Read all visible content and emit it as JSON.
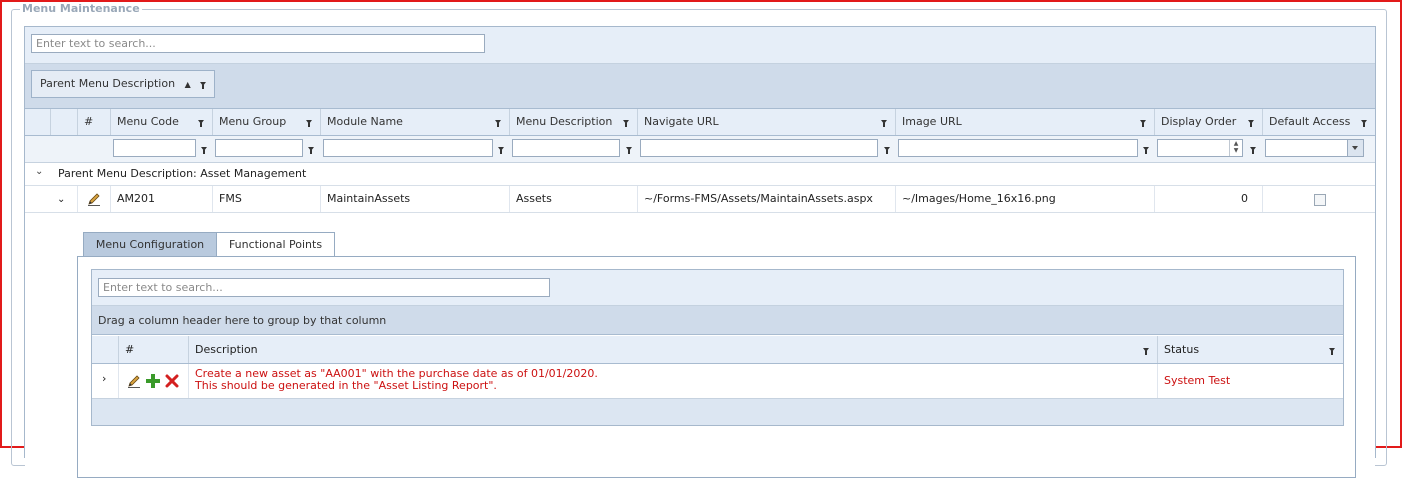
{
  "section_title": "Menu Maintenance",
  "search_placeholder": "Enter text to search...",
  "group_chip": {
    "label": "Parent Menu Description",
    "sort": "▲"
  },
  "columns": [
    "#",
    "Menu Code",
    "Menu Group",
    "Module Name",
    "Menu Description",
    "Navigate URL",
    "Image URL",
    "Display Order",
    "Default Access"
  ],
  "group_row": "Parent Menu Description: Asset Management",
  "row": {
    "menu_code": "AM201",
    "menu_group": "FMS",
    "module_name": "MaintainAssets",
    "menu_description": "Assets",
    "navigate_url": "~/Forms-FMS/Assets/MaintainAssets.aspx",
    "image_url": "~/Images/Home_16x16.png",
    "display_order": "0",
    "default_access": false
  },
  "tabs": [
    "Menu Configuration",
    "Functional Points"
  ],
  "active_tab": "Functional Points",
  "sub_grid": {
    "search_placeholder": "Enter text to search...",
    "group_hint": "Drag a column header here to group by that column",
    "columns": [
      "#",
      "Description",
      "Status"
    ],
    "rows": [
      {
        "description_line1": "Create a new asset as \"AA001\" with the purchase date as of 01/01/2020.",
        "description_line2": "This should be generated in the \"Asset Listing Report\".",
        "status": "System Test"
      }
    ]
  },
  "colors": {
    "frame": "#e21a1a",
    "accent": "#cc1111",
    "header_bg": "#e6eef8",
    "group_bg": "#cfdbea"
  }
}
